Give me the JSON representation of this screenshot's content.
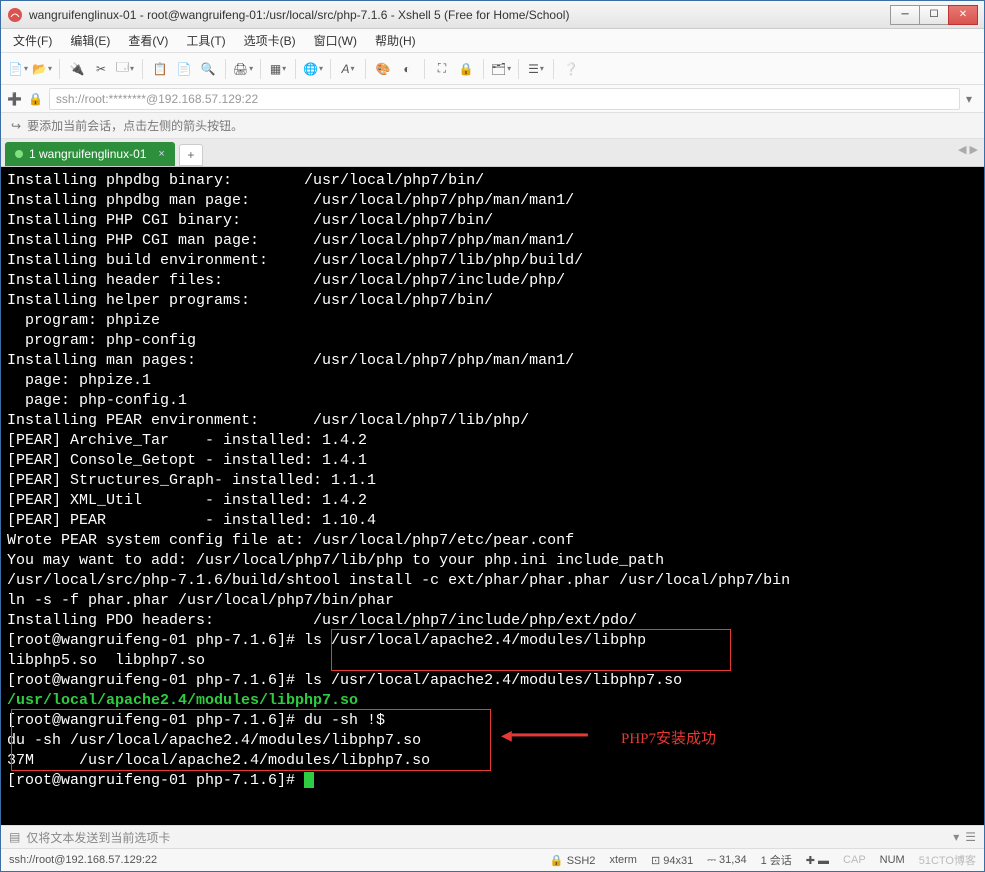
{
  "window": {
    "title": "wangruifenglinux-01 - root@wangruifeng-01:/usr/local/src/php-7.1.6 - Xshell 5 (Free for Home/School)"
  },
  "menu": {
    "file": "文件(F)",
    "edit": "编辑(E)",
    "view": "查看(V)",
    "tools": "工具(T)",
    "tabs": "选项卡(B)",
    "window": "窗口(W)",
    "help": "帮助(H)"
  },
  "address": {
    "text": "ssh://root:********@192.168.57.129:22"
  },
  "infobar": {
    "text": "要添加当前会话，点击左侧的箭头按钮。"
  },
  "tab": {
    "label": "1 wangruifenglinux-01"
  },
  "annotation": {
    "label": "PHP7安装成功"
  },
  "terminal_lines": [
    {
      "t": "plain",
      "s": "Installing phpdbg binary:        /usr/local/php7/bin/"
    },
    {
      "t": "plain",
      "s": "Installing phpdbg man page:       /usr/local/php7/php/man/man1/"
    },
    {
      "t": "plain",
      "s": "Installing PHP CGI binary:        /usr/local/php7/bin/"
    },
    {
      "t": "plain",
      "s": "Installing PHP CGI man page:      /usr/local/php7/php/man/man1/"
    },
    {
      "t": "plain",
      "s": "Installing build environment:     /usr/local/php7/lib/php/build/"
    },
    {
      "t": "plain",
      "s": "Installing header files:          /usr/local/php7/include/php/"
    },
    {
      "t": "plain",
      "s": "Installing helper programs:       /usr/local/php7/bin/"
    },
    {
      "t": "plain",
      "s": "  program: phpize"
    },
    {
      "t": "plain",
      "s": "  program: php-config"
    },
    {
      "t": "plain",
      "s": "Installing man pages:             /usr/local/php7/php/man/man1/"
    },
    {
      "t": "plain",
      "s": "  page: phpize.1"
    },
    {
      "t": "plain",
      "s": "  page: php-config.1"
    },
    {
      "t": "plain",
      "s": "Installing PEAR environment:      /usr/local/php7/lib/php/"
    },
    {
      "t": "plain",
      "s": "[PEAR] Archive_Tar    - installed: 1.4.2"
    },
    {
      "t": "plain",
      "s": "[PEAR] Console_Getopt - installed: 1.4.1"
    },
    {
      "t": "plain",
      "s": "[PEAR] Structures_Graph- installed: 1.1.1"
    },
    {
      "t": "plain",
      "s": "[PEAR] XML_Util       - installed: 1.4.2"
    },
    {
      "t": "plain",
      "s": "[PEAR] PEAR           - installed: 1.10.4"
    },
    {
      "t": "plain",
      "s": "Wrote PEAR system config file at: /usr/local/php7/etc/pear.conf"
    },
    {
      "t": "plain",
      "s": "You may want to add: /usr/local/php7/lib/php to your php.ini include_path"
    },
    {
      "t": "plain",
      "s": "/usr/local/src/php-7.1.6/build/shtool install -c ext/phar/phar.phar /usr/local/php7/bin"
    },
    {
      "t": "plain",
      "s": "ln -s -f phar.phar /usr/local/php7/bin/phar"
    },
    {
      "t": "plain",
      "s": "Installing PDO headers:           /usr/local/php7/include/php/ext/pdo/"
    },
    {
      "t": "prompt",
      "cmd": "ls /usr/local/apache2.4/modules/libphp"
    },
    {
      "t": "plain",
      "s": "libphp5.so  libphp7.so"
    },
    {
      "t": "prompt",
      "cmd": "ls /usr/local/apache2.4/modules/libphp7.so"
    },
    {
      "t": "green",
      "s": "/usr/local/apache2.4/modules/libphp7.so"
    },
    {
      "t": "prompt",
      "cmd": "du -sh !$"
    },
    {
      "t": "plain",
      "s": "du -sh /usr/local/apache2.4/modules/libphp7.so"
    },
    {
      "t": "plain",
      "s": "37M     /usr/local/apache2.4/modules/libphp7.so"
    },
    {
      "t": "prompt_cursor",
      "cmd": ""
    }
  ],
  "prompt": {
    "user": "root",
    "host": "wangruifeng-01",
    "cwd": "php-7.1.6"
  },
  "sendbar": {
    "text": "仅将文本发送到当前选项卡"
  },
  "status": {
    "left": "ssh://root@192.168.57.129:22",
    "ssh": "SSH2",
    "term": "xterm",
    "size": "94x31",
    "pos": "31,34",
    "sess": "1 会话",
    "cap": "CAP",
    "num": "NUM",
    "watermark": "51CTO博客"
  }
}
